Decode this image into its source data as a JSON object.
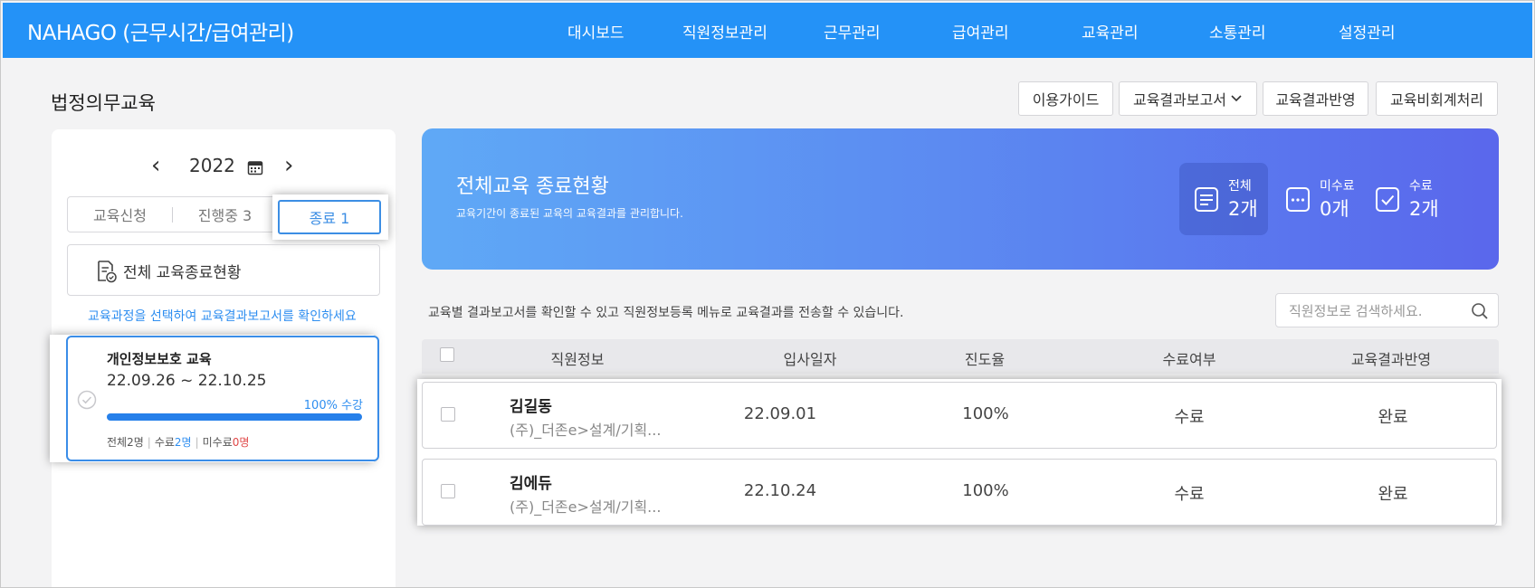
{
  "app": {
    "brand": "NAHAGO (근무시간/급여관리)",
    "nav": [
      "대시보드",
      "직원정보관리",
      "근무관리",
      "급여관리",
      "교육관리",
      "소통관리",
      "설정관리"
    ],
    "accent": "#2492f7"
  },
  "page": {
    "title": "법정의무교육",
    "buttons": {
      "guide": "이용가이드",
      "report": "교육결과보고서",
      "apply": "교육결과반영",
      "cost": "교육비회계처리"
    }
  },
  "sidebar": {
    "year": "2022",
    "tabs": {
      "apply": "교육신청",
      "progress": "진행중 3",
      "done": "종료 1"
    },
    "all_status": "전체 교육종료현황",
    "hint": "교육과정을 선택하여 교육결과보고서를 확인하세요",
    "course": {
      "name": "개인정보보호 교육",
      "period": "22.09.26 ~ 22.10.25",
      "progress_label": "100% 수강",
      "progress": 1.0,
      "stat_total": "전체2명",
      "stat_done_label": "수료",
      "stat_done_value": "2명",
      "stat_undone_label": "미수료",
      "stat_undone_value": "0명"
    }
  },
  "banner": {
    "title": "전체교육 종료현황",
    "subtitle": "교육기간이 종료된 교육의 교육결과를 관리합니다.",
    "stats": [
      {
        "label": "전체",
        "value": "2개",
        "icon": "list-icon"
      },
      {
        "label": "미수료",
        "value": "0개",
        "icon": "dots-icon"
      },
      {
        "label": "수료",
        "value": "2개",
        "icon": "check-icon"
      }
    ]
  },
  "list": {
    "description": "교육별 결과보고서를 확인할 수 있고 직원정보등록 메뉴로 교육결과를 전송할 수 있습니다.",
    "search_placeholder": "직원정보로 검색하세요.",
    "headers": [
      "직원정보",
      "입사일자",
      "진도율",
      "수료여부",
      "교육결과반영"
    ],
    "rows": [
      {
        "name": "김길동",
        "dept": "(주)_더존e>설계/기획...",
        "join_date": "22.09.01",
        "progress": "100%",
        "status": "수료",
        "applied": "완료"
      },
      {
        "name": "김에듀",
        "dept": "(주)_더존e>설계/기획...",
        "join_date": "22.10.24",
        "progress": "100%",
        "status": "수료",
        "applied": "완료"
      }
    ]
  }
}
